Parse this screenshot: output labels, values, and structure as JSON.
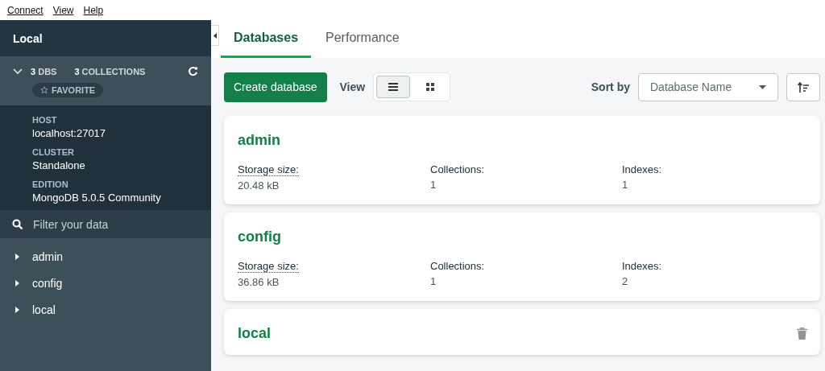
{
  "menu_bar": [
    "Connect",
    "View",
    "Help"
  ],
  "sidebar": {
    "title": "Local",
    "stats": [
      {
        "count": "3",
        "label": "DBS"
      },
      {
        "count": "3",
        "label": "COLLECTIONS"
      }
    ],
    "favorite": "FAVORITE",
    "info": [
      {
        "label": "HOST",
        "value": "localhost:27017"
      },
      {
        "label": "CLUSTER",
        "value": "Standalone"
      },
      {
        "label": "EDITION",
        "value": "MongoDB 5.0.5 Community"
      }
    ],
    "filter": {
      "placeholder": "Filter your data"
    },
    "databases": [
      "admin",
      "config",
      "local"
    ]
  },
  "tabs": [
    {
      "label": "Databases",
      "selected": true
    },
    {
      "label": "Performance",
      "selected": false
    }
  ],
  "toolbar": {
    "create_button": "Create database",
    "view_label": "View",
    "view_modes": [
      {
        "kind": "list",
        "selected": true
      },
      {
        "kind": "grid",
        "selected": false
      }
    ],
    "sort_label": "Sort by",
    "sort_value": "Database Name"
  },
  "databases": [
    {
      "name": "admin",
      "fields": [
        {
          "label": "Storage size:",
          "value": "20.48 kB",
          "dotted": true
        },
        {
          "label": "Collections:",
          "value": "1",
          "dotted": false
        },
        {
          "label": "Indexes:",
          "value": "1",
          "dotted": false
        }
      ],
      "show_delete": false
    },
    {
      "name": "config",
      "fields": [
        {
          "label": "Storage size:",
          "value": "36.86 kB",
          "dotted": true
        },
        {
          "label": "Collections:",
          "value": "1",
          "dotted": false
        },
        {
          "label": "Indexes:",
          "value": "2",
          "dotted": false
        }
      ],
      "show_delete": false
    },
    {
      "name": "local",
      "show_delete": true
    }
  ]
}
